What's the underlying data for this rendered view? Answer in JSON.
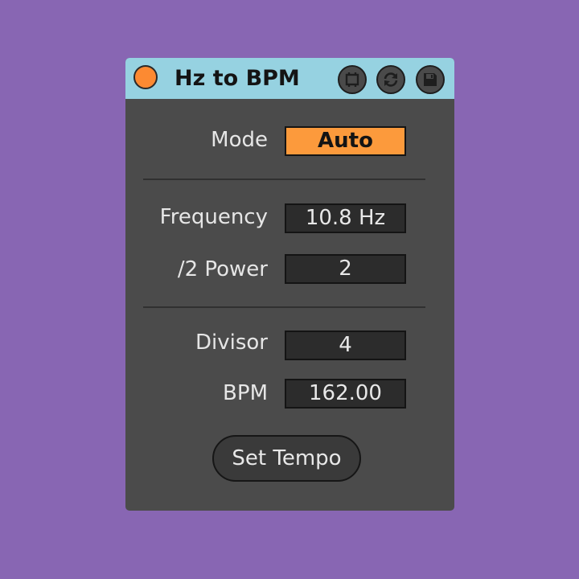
{
  "device": {
    "title": "Hz to BPM",
    "header_icons": [
      "freeze-icon",
      "refresh-icon",
      "save-icon"
    ]
  },
  "controls": {
    "mode": {
      "label": "Mode",
      "value": "Auto"
    },
    "frequency": {
      "label": "Frequency",
      "value": "10.8 Hz"
    },
    "power": {
      "label": "/2  Power",
      "value": "2"
    },
    "divisor": {
      "label": "Divisor",
      "value": "4"
    },
    "bpm": {
      "label": "BPM",
      "value": "162.00"
    },
    "set_tempo": {
      "label": "Set Tempo"
    }
  },
  "colors": {
    "background": "#8866b3",
    "titlebar": "#96d2e1",
    "panel": "#4b4b4b",
    "accent": "#fc9a3c"
  }
}
